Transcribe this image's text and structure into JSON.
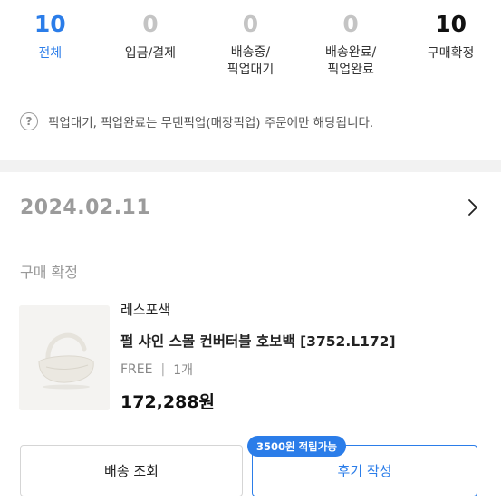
{
  "stats": [
    {
      "count": "10",
      "label": "전체"
    },
    {
      "count": "0",
      "label": "입금/결제"
    },
    {
      "count": "0",
      "label_line1": "배송중/",
      "label_line2": "픽업대기"
    },
    {
      "count": "0",
      "label_line1": "배송완료/",
      "label_line2": "픽업완료"
    },
    {
      "count": "10",
      "label": "구매확정"
    }
  ],
  "notice": {
    "icon": "question-circle-icon",
    "text": "픽업대기, 픽업완료는 무탠픽업(매장픽업) 주문에만 해당됩니다."
  },
  "order": {
    "date": "2024.02.11",
    "status": "구매 확정",
    "item": {
      "brand": "레스포색",
      "name": "펄 샤인 스몰 컨버터블 호보백 [3752.L172]",
      "option": "FREE",
      "quantity": "1개",
      "price": "172,288원"
    },
    "actions": {
      "ship_label": "배송 조회",
      "review_label": "후기 작성",
      "review_badge": "3500원 적립가능"
    }
  },
  "colors": {
    "accent": "#2b7de9",
    "muted": "#c4c4c4",
    "divider": "#f2f2f2"
  }
}
